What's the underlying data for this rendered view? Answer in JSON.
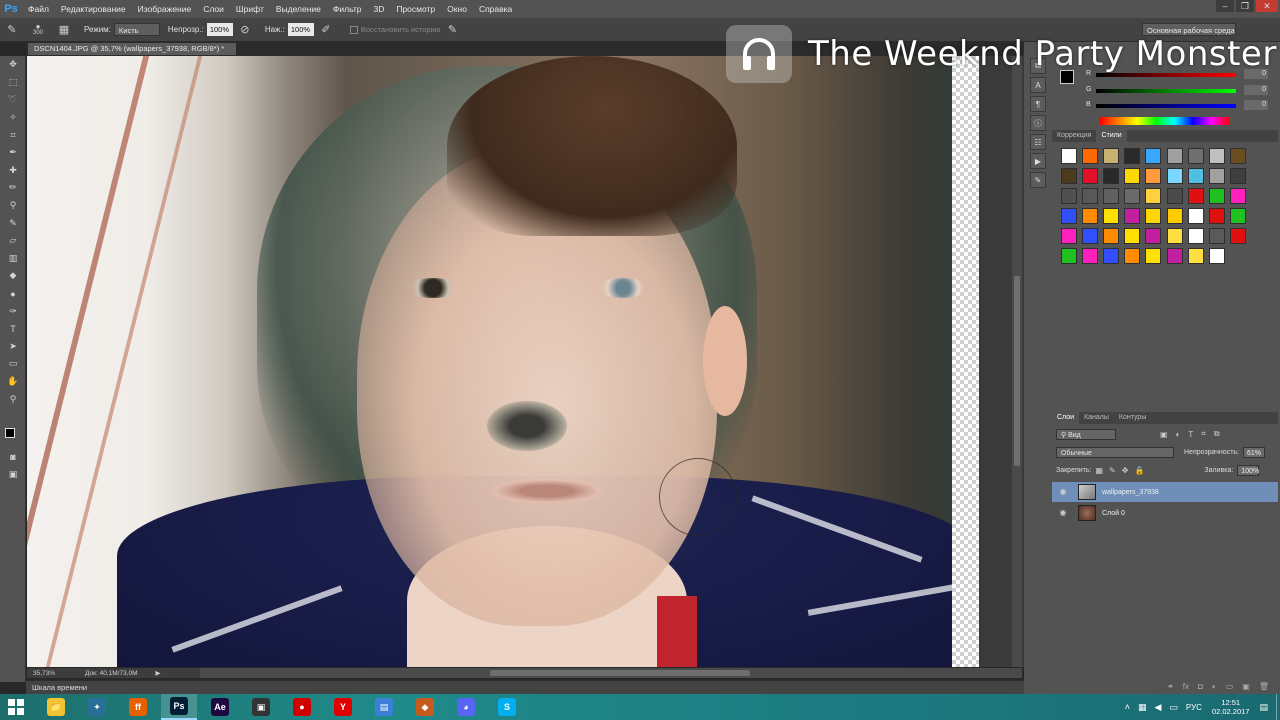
{
  "app": {
    "logo": "Ps"
  },
  "menu": [
    "Файл",
    "Редактирование",
    "Изображение",
    "Слои",
    "Шрифт",
    "Выделение",
    "Фильтр",
    "3D",
    "Просмотр",
    "Окно",
    "Справка"
  ],
  "window_controls": {
    "minimize": "–",
    "maximize": "❐",
    "close": "✕"
  },
  "options": {
    "brush_size": "300",
    "mode_label": "Режим:",
    "mode_value": "Кисть",
    "opacity_label": "Непрозр.:",
    "opacity_value": "100%",
    "pressure_label": "Наж.:",
    "pressure_value": "100%",
    "history_label": "Восстановить историю",
    "workspace": "Основная рабочая среда"
  },
  "document": {
    "tab_title": "DSCN1404.JPG @ 35,7% (wallpapers_37938, RGB/8*) *",
    "zoom": "35,73%",
    "doc_info": "Док: 40,1M/73,0M"
  },
  "timeline_label": "Шкала времени",
  "overlay": {
    "song_title": "The Weeknd Party Monster",
    "icon": "headphones-icon"
  },
  "color_panel": {
    "channels": [
      {
        "label": "R",
        "value": "0",
        "color": "#e02020"
      },
      {
        "label": "G",
        "value": "0",
        "color": "#20c020"
      },
      {
        "label": "B",
        "value": "0",
        "color": "#2040e0"
      }
    ]
  },
  "styles_panel": {
    "tabs": [
      "Коррекция",
      "Стили"
    ],
    "active_tab": "Стили",
    "swatch_colors": [
      "#ffffff",
      "#ff6a00",
      "#c8b070",
      "#2a2a2a",
      "#38a8ff",
      "#a0a0a0",
      "#707070",
      "#c0c0c0",
      "#6b4d22",
      "#4b3a1c",
      "#e0102a",
      "#2a2a2a",
      "#ffd700",
      "#ff9a40",
      "#7ad7ff",
      "#50c0e0",
      "#a0a0a0",
      "#3e3e3e",
      "#505050",
      "#585858",
      "#606060",
      "#6a6a6a",
      "#ffd040",
      "#4a4a4a",
      "#e01010",
      "#20c020",
      "#ff20c0",
      "#3050ff",
      "#ff8c00",
      "#ffe000",
      "#c020a0",
      "#ffd700",
      "#ffcc00",
      "#ffffff",
      "#e01010",
      "#20c020",
      "#ff20c0",
      "#3050ff",
      "#ff8c00",
      "#ffe000",
      "#c020a0",
      "#ffe040",
      "#ffffff",
      "#5a5a5a",
      "#e01010",
      "#20c020",
      "#ff20c0",
      "#3050ff",
      "#ff8c00",
      "#ffe000",
      "#c020a0",
      "#ffe040",
      "#ffffff"
    ]
  },
  "layers_panel": {
    "tabs": [
      "Слои",
      "Каналы",
      "Контуры"
    ],
    "active_tab": "Слои",
    "filter_label": "Вид",
    "blend_mode": "Обычные",
    "opacity_label": "Непрозрачность:",
    "opacity_value": "61%",
    "lock_label": "Закрепить:",
    "fill_label": "Заливка:",
    "fill_value": "100%",
    "layers": [
      {
        "name": "wallpapers_37938",
        "selected": true
      },
      {
        "name": "Слой 0",
        "selected": false
      }
    ]
  },
  "taskbar": {
    "apps": [
      {
        "name": "explorer",
        "label": "📁",
        "color": "#f1c232"
      },
      {
        "name": "app2",
        "label": "✦",
        "color": "#2a6f97"
      },
      {
        "name": "firefox",
        "label": "ff",
        "color": "#e66000"
      },
      {
        "name": "photoshop",
        "label": "Ps",
        "color": "#001e36"
      },
      {
        "name": "after-effects",
        "label": "Ae",
        "color": "#1f0740"
      },
      {
        "name": "app6",
        "label": "▣",
        "color": "#333333"
      },
      {
        "name": "recorder",
        "label": "●",
        "color": "#d00000"
      },
      {
        "name": "yandex",
        "label": "Y",
        "color": "#e00000"
      },
      {
        "name": "app9",
        "label": "▤",
        "color": "#3b7fd8"
      },
      {
        "name": "app10",
        "label": "◆",
        "color": "#c85a1e"
      },
      {
        "name": "discord",
        "label": "◕",
        "color": "#5865f2"
      },
      {
        "name": "skype",
        "label": "S",
        "color": "#00aff0"
      }
    ],
    "active_app": "photoshop",
    "language": "РУС",
    "time": "12:51",
    "date": "02.02.2017"
  }
}
